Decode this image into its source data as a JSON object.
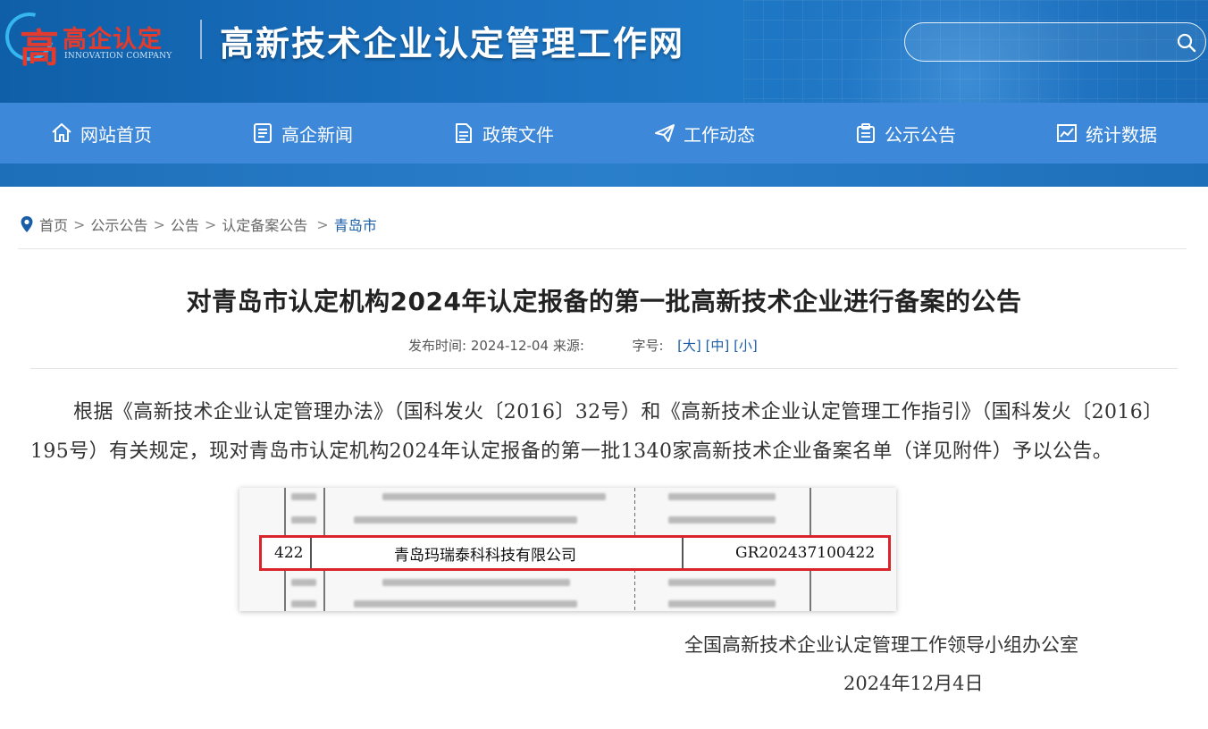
{
  "header": {
    "logo_mark": "高",
    "logo_cn": "高企认定",
    "logo_en": "INNOVATION COMPANY",
    "site_title": "高新技术企业认定管理工作网",
    "search": {
      "value": "",
      "placeholder": ""
    }
  },
  "nav": {
    "items": [
      {
        "label": "网站首页",
        "icon": "home-icon"
      },
      {
        "label": "高企新闻",
        "icon": "news-icon"
      },
      {
        "label": "政策文件",
        "icon": "document-icon"
      },
      {
        "label": "工作动态",
        "icon": "paper-plane-icon"
      },
      {
        "label": "公示公告",
        "icon": "clipboard-icon"
      },
      {
        "label": "统计数据",
        "icon": "chart-icon"
      }
    ]
  },
  "breadcrumb": {
    "items": [
      "首页",
      "公示公告",
      "公告",
      "认定备案公告",
      "青岛市"
    ],
    "separator": ">"
  },
  "article": {
    "title": "对青岛市认定机构2024年认定报备的第一批高新技术企业进行备案的公告",
    "meta": {
      "published_label": "发布时间:",
      "published_date": "2024-12-04",
      "source_label": "来源:",
      "font_size_label": "字号:",
      "size_large": "[大]",
      "size_medium": "[中]",
      "size_small": "[小]"
    },
    "body": "根据《高新技术企业认定管理办法》（国科发火〔2016〕32号）和《高新技术企业认定管理工作指引》（国科发火〔2016〕195号）有关规定，现对青岛市认定机构2024年认定报备的第一批1340家高新技术企业备案名单（详见附件）予以公告。",
    "highlighted_row": {
      "index": "422",
      "company": "青岛玛瑞泰科科技有限公司",
      "certificate": "GR202437100422"
    },
    "signature": "全国高新技术企业认定管理工作领导小组办公室",
    "date": "2024年12月4日"
  },
  "colors": {
    "header_bg": "#1a6fbd",
    "nav_bg": "#3d88d8",
    "highlight_border": "#d9242c",
    "link": "#1b5ea8"
  }
}
